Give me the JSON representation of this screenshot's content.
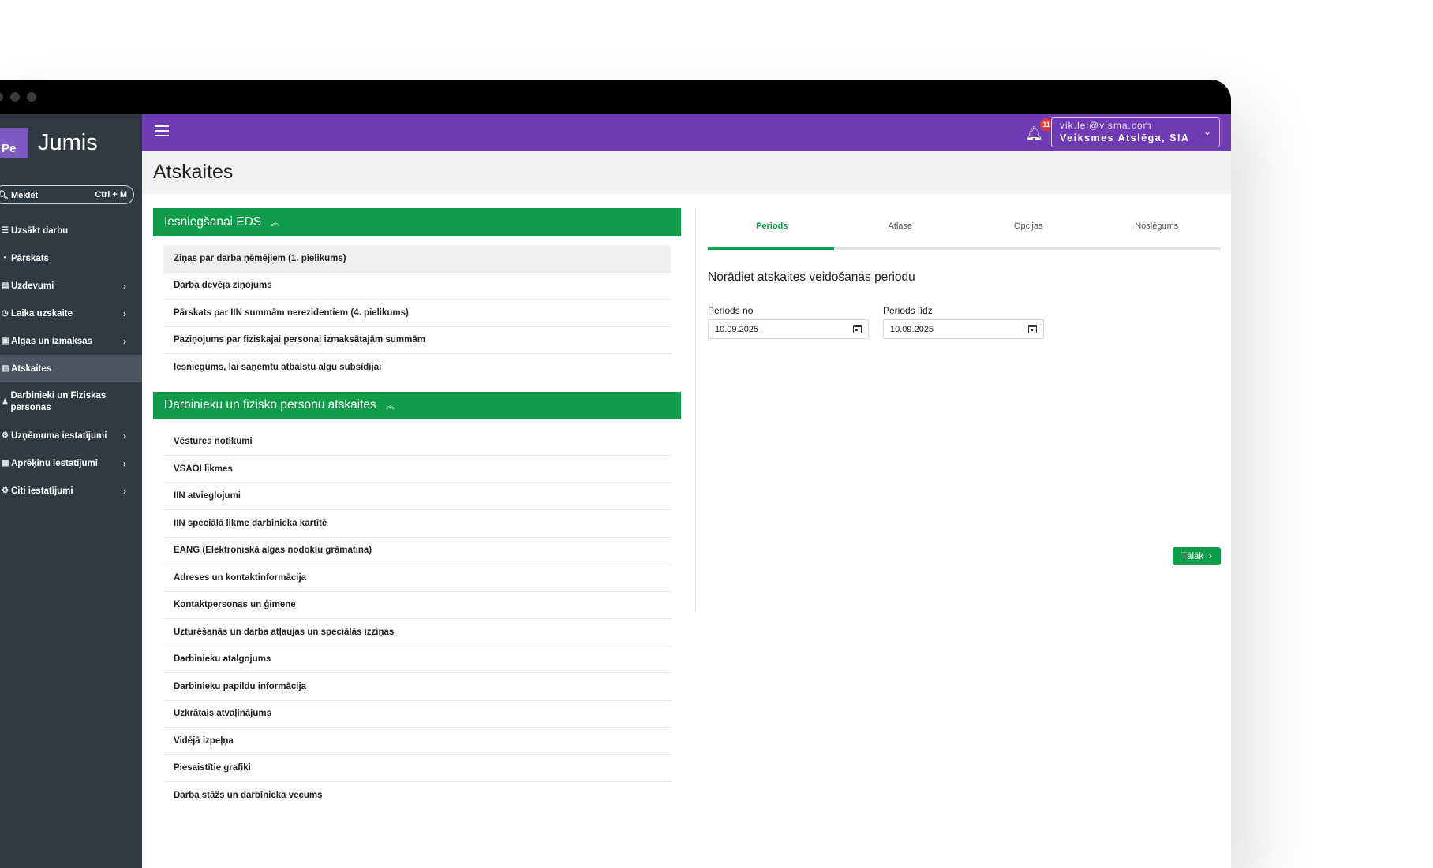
{
  "brand": {
    "badge": "Pe",
    "name": "Jumis"
  },
  "search": {
    "label": "Meklēt",
    "shortcut": "Ctrl + M"
  },
  "sidebar": {
    "items": [
      {
        "label": "Uzsākt darbu",
        "icon": "list-icon",
        "chevron": false,
        "active": false
      },
      {
        "label": "Pārskats",
        "icon": "gauge-icon",
        "chevron": false,
        "active": false
      },
      {
        "label": "Uzdevumi",
        "icon": "clipboard-icon",
        "chevron": true,
        "active": false
      },
      {
        "label": "Laika uzskaite",
        "icon": "clock-icon",
        "chevron": true,
        "active": false
      },
      {
        "label": "Algas un izmaksas",
        "icon": "wallet-icon",
        "chevron": true,
        "active": false
      },
      {
        "label": "Atskaites",
        "icon": "report-icon",
        "chevron": false,
        "active": true
      },
      {
        "label": "Darbinieki un Fiziskas personas",
        "icon": "people-icon",
        "chevron": false,
        "active": false
      },
      {
        "label": "Uzņēmuma iestatījumi",
        "icon": "building-gear-icon",
        "chevron": true,
        "active": false
      },
      {
        "label": "Aprēķinu iestatījumi",
        "icon": "calculator-icon",
        "chevron": true,
        "active": false
      },
      {
        "label": "Citi iestatījumi",
        "icon": "gear-icon",
        "chevron": true,
        "active": false
      }
    ]
  },
  "topbar": {
    "notifications_count": "11",
    "account_email": "vik.lei@visma.com",
    "account_company": "Veiksmes Atslēga, SIA"
  },
  "page": {
    "title": "Atskaites"
  },
  "sections": [
    {
      "title": "Iesniegšanai EDS",
      "items": [
        "Ziņas par darba ņēmējiem (1. pielikums)",
        "Darba devēja ziņojums",
        "Pārskats par IIN summām nerezidentiem (4. pielikums)",
        "Paziņojums par fiziskajai personai izmaksātajām summām",
        "Iesniegums, lai saņemtu atbalstu algu subsīdijai"
      ]
    },
    {
      "title": "Darbinieku un fizisko personu atskaites",
      "items": [
        "Vēstures notikumi",
        "VSAOI likmes",
        "IIN atvieglojumi",
        "IIN speciālā likme darbinieka kartītē",
        "EANG (Elektroniskā algas nodokļu grāmatiņa)",
        "Adreses un kontaktinformācija",
        "Kontaktpersonas un ģimene",
        "Uzturēšanās un darba atļaujas un speciālās izziņas",
        "Darbinieku atalgojums",
        "Darbinieku papildu informācija",
        "Uzkrātais atvaļinājums",
        "Vidējā izpeļņa",
        "Piesaistītie grafiki",
        "Darba stāžs un darbinieka vecums"
      ]
    }
  ],
  "wizard": {
    "tabs": [
      "Periods",
      "Atlase",
      "Opcijas",
      "Noslēgums"
    ],
    "active_tab": 0,
    "heading": "Norādiet atskaites veidošanas periodu",
    "from_label": "Periods no",
    "from_value": "10.09.2025",
    "to_label": "Periods līdz",
    "to_value": "10.09.2025",
    "next_label": "Tālāk"
  },
  "colors": {
    "purple": "#6f3bb4",
    "green": "#0f9d4a",
    "sidebar": "#2f3a45",
    "badge": "#e53935"
  }
}
